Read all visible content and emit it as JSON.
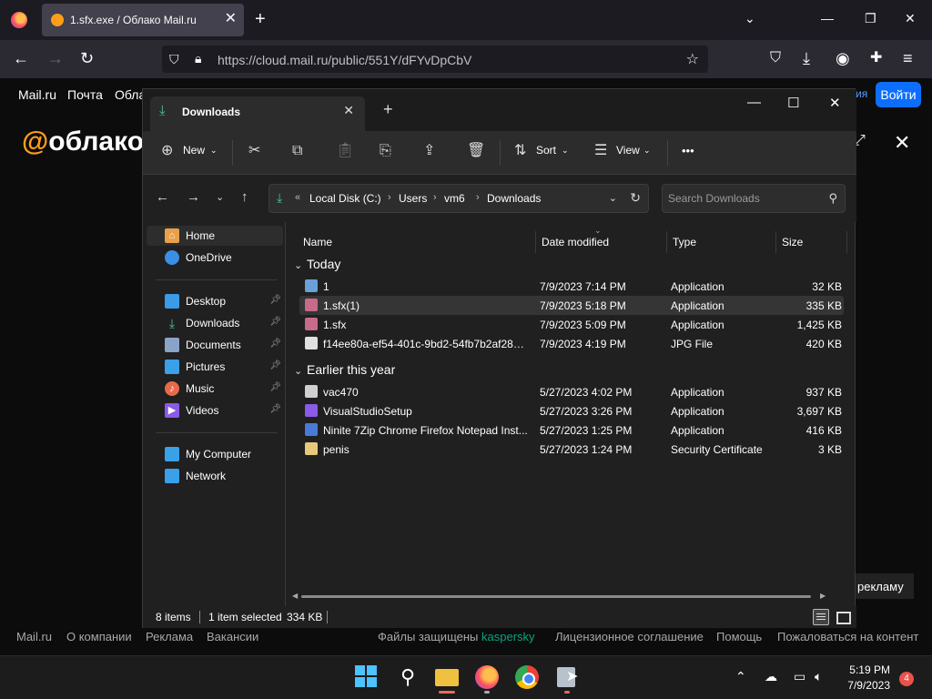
{
  "browser": {
    "tab_title": "1.sfx.exe / Облако Mail.ru",
    "url": "https://cloud.mail.ru/public/551Y/dFYvDpCbV"
  },
  "webpage": {
    "top_links": [
      "Mail.ru",
      "Почта",
      "Обла"
    ],
    "login_label": "Войти",
    "link_cut": "ия",
    "logo_text": "облако",
    "logo_at": "@",
    "report_label": "рекламу",
    "footer_links": [
      "Mail.ru",
      "О компании",
      "Реклама",
      "Вакансии"
    ],
    "footer_protected": "Файлы защищены",
    "footer_kaspersky": "kaspersky",
    "footer_right": [
      "Лицензионное соглашение",
      "Помощь",
      "Пожаловаться на контент"
    ]
  },
  "explorer": {
    "tab_title": "Downloads",
    "toolbar": {
      "new_label": "New",
      "sort_label": "Sort",
      "view_label": "View",
      "more_label": "•••"
    },
    "address": {
      "back": "«",
      "crumbs": [
        "Local Disk (C:)",
        "Users",
        "vm6",
        "Downloads"
      ]
    },
    "search_placeholder": "Search Downloads",
    "sidebar": {
      "items": [
        {
          "label": "Home",
          "icon": "home-icon",
          "color": "#e8a04a"
        },
        {
          "label": "OneDrive",
          "icon": "cloud-icon",
          "color": "#3a8ee6"
        },
        {
          "label": "Desktop",
          "icon": "desktop-icon",
          "color": "#3a9be8"
        },
        {
          "label": "Downloads",
          "icon": "download-icon",
          "color": "#4cc2a0"
        },
        {
          "label": "Documents",
          "icon": "document-icon",
          "color": "#8aa4c8"
        },
        {
          "label": "Pictures",
          "icon": "picture-icon",
          "color": "#3aa0e8"
        },
        {
          "label": "Music",
          "icon": "music-icon",
          "color": "#e86a4a"
        },
        {
          "label": "Videos",
          "icon": "video-icon",
          "color": "#8a5ae8"
        },
        {
          "label": "My Computer",
          "icon": "computer-icon",
          "color": "#3aa0e8"
        },
        {
          "label": "Network",
          "icon": "network-icon",
          "color": "#3aa0e8"
        }
      ]
    },
    "columns": [
      "Name",
      "Date modified",
      "Type",
      "Size"
    ],
    "groups": [
      {
        "label": "Today",
        "files": [
          {
            "name": "1",
            "date": "7/9/2023 7:14 PM",
            "type": "Application",
            "size": "32 KB",
            "icon_color": "#6aa0d8"
          },
          {
            "name": "1.sfx(1)",
            "date": "7/9/2023 5:18 PM",
            "type": "Application",
            "size": "335 KB",
            "icon_color": "#c86a8a"
          },
          {
            "name": "1.sfx",
            "date": "7/9/2023 5:09 PM",
            "type": "Application",
            "size": "1,425 KB",
            "icon_color": "#c86a8a"
          },
          {
            "name": "f14ee80a-ef54-401c-9bd2-54fb7b2af289.0...",
            "date": "7/9/2023 4:19 PM",
            "type": "JPG File",
            "size": "420 KB",
            "icon_color": "#e0e0e0"
          }
        ]
      },
      {
        "label": "Earlier this year",
        "files": [
          {
            "name": "vac470",
            "date": "5/27/2023 4:02 PM",
            "type": "Application",
            "size": "937 KB",
            "icon_color": "#d0d0d0"
          },
          {
            "name": "VisualStudioSetup",
            "date": "5/27/2023 3:26 PM",
            "type": "Application",
            "size": "3,697 KB",
            "icon_color": "#8a5ae8"
          },
          {
            "name": "Ninite 7Zip Chrome Firefox Notepad Inst...",
            "date": "5/27/2023 1:25 PM",
            "type": "Application",
            "size": "416 KB",
            "icon_color": "#4a7ad8"
          },
          {
            "name": "penis",
            "date": "5/27/2023 1:24 PM",
            "type": "Security Certificate",
            "size": "3 KB",
            "icon_color": "#e8c87a"
          }
        ]
      }
    ],
    "status": {
      "count": "8 items",
      "selected": "1 item selected",
      "selected_size": "334 KB"
    }
  },
  "taskbar": {
    "time": "5:19 PM",
    "date": "7/9/2023",
    "badge": "4"
  }
}
